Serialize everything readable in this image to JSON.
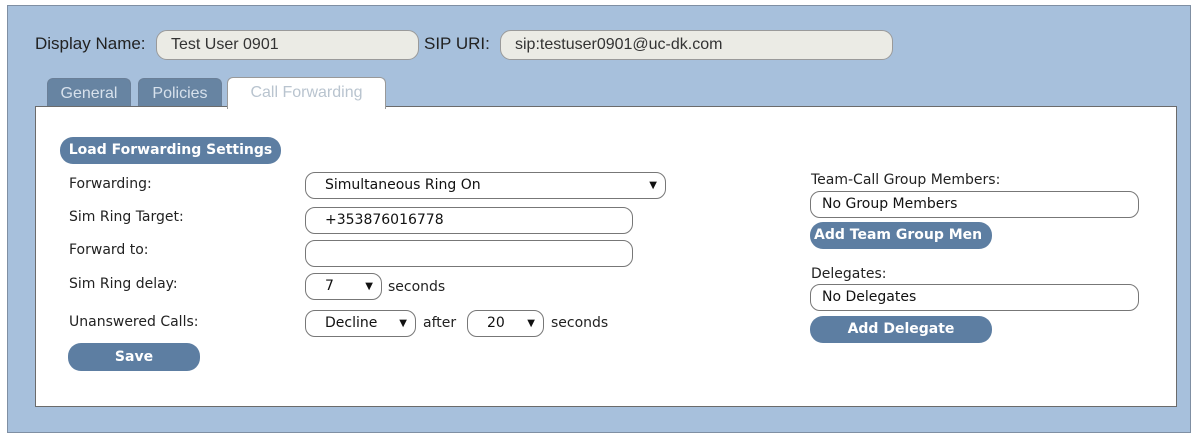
{
  "header": {
    "display_name_label": "Display Name:",
    "display_name_value": "Test User 0901",
    "sip_uri_label": "SIP URI:",
    "sip_uri_value": "sip:testuser0901@uc-dk.com"
  },
  "tabs": [
    {
      "label": "General",
      "active": false
    },
    {
      "label": "Policies",
      "active": false
    },
    {
      "label": "Call Forwarding",
      "active": true
    }
  ],
  "forwarding": {
    "load_button": "Load Forwarding Settings",
    "forwarding_label": "Forwarding:",
    "forwarding_value": "Simultaneous Ring On",
    "sim_ring_target_label": "Sim Ring Target:",
    "sim_ring_target_value": "+353876016778",
    "forward_to_label": "Forward to:",
    "forward_to_value": "",
    "sim_ring_delay_label": "Sim Ring delay:",
    "sim_ring_delay_value": "7",
    "seconds_label": "seconds",
    "unanswered_label": "Unanswered Calls:",
    "unanswered_action": "Decline",
    "after_label": "after",
    "unanswered_delay": "20",
    "save_button": "Save"
  },
  "team_call": {
    "label": "Team-Call Group Members:",
    "value": "No Group Members",
    "add_button": "Add Team Group Men"
  },
  "delegates": {
    "label": "Delegates:",
    "value": "No Delegates",
    "add_button": "Add Delegate"
  },
  "colors": {
    "background": "#a7c0dc",
    "button": "#5d7ea2",
    "tab_inactive": "#6784a2",
    "field_bg": "#ebebe5"
  },
  "icons": {
    "dropdown": "triangle-down-icon"
  }
}
